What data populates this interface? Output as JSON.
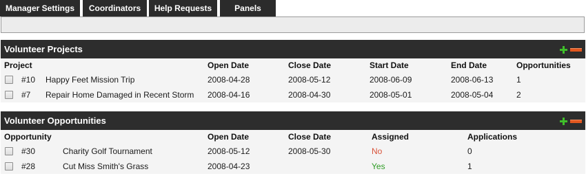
{
  "tabs": [
    {
      "label": "Manager Settings"
    },
    {
      "label": "Coordinators"
    },
    {
      "label": "Help Requests"
    },
    {
      "label": "Panels"
    }
  ],
  "projects": {
    "title": "Volunteer Projects",
    "columns": [
      "Project",
      "Open Date",
      "Close Date",
      "Start Date",
      "End Date",
      "Opportunities"
    ],
    "rows": [
      {
        "id": "#10",
        "name": "Happy Feet Mission Trip",
        "open": "2008-04-28",
        "close": "2008-05-12",
        "start": "2008-06-09",
        "end": "2008-06-13",
        "opportunities": "1"
      },
      {
        "id": "#7",
        "name": "Repair Home Damaged in Recent Storm",
        "open": "2008-04-16",
        "close": "2008-04-30",
        "start": "2008-05-01",
        "end": "2008-05-04",
        "opportunities": "2"
      }
    ]
  },
  "opportunities": {
    "title": "Volunteer Opportunities",
    "columns": [
      "Opportunity",
      "Open Date",
      "Close Date",
      "Assigned",
      "Applications"
    ],
    "rows": [
      {
        "id": "#30",
        "name": "Charity Golf Tournament",
        "open": "2008-05-12",
        "close": "2008-05-30",
        "assigned": "No",
        "applications": "0"
      },
      {
        "id": "#28",
        "name": "Cut Miss Smith's Grass",
        "open": "2008-04-23",
        "close": "",
        "assigned": "Yes",
        "applications": "1"
      }
    ]
  },
  "colors": {
    "header_bg": "#2d2d2d",
    "add_icon": "#3fbf2a",
    "remove_icon": "#e2571f",
    "assigned_no": "#d9533a",
    "assigned_yes": "#2e9c25"
  },
  "icons": [
    "add-icon",
    "remove-icon",
    "checkbox"
  ]
}
